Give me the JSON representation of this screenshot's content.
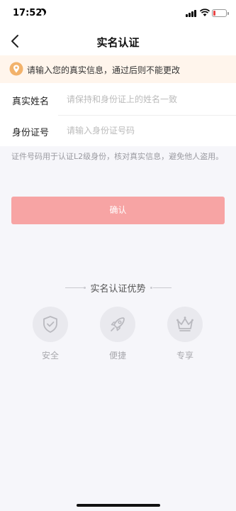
{
  "status_bar": {
    "time": "17:52",
    "icons": [
      "moon-icon",
      "signal-icon",
      "wifi-icon",
      "battery-icon"
    ],
    "battery_level": 0.15
  },
  "nav": {
    "title": "实名认证",
    "back_icon": "chevron-left-icon"
  },
  "notice": {
    "icon": "location-pin-icon",
    "text": "请输入您的真实信息，通过后则不能更改"
  },
  "form": {
    "name": {
      "label": "真实姓名",
      "placeholder": "请保持和身份证上的姓名一致",
      "value": ""
    },
    "id_number": {
      "label": "身份证号",
      "placeholder": "请输入身份证号码",
      "value": ""
    }
  },
  "hint": "证件号码用于认证L2级身份，核对真实信息，避免他人盗用。",
  "confirm_label": "确认",
  "advantages": {
    "title": "实名认证优势",
    "items": [
      {
        "label": "安全",
        "icon": "shield-check-icon"
      },
      {
        "label": "便捷",
        "icon": "rocket-icon"
      },
      {
        "label": "专享",
        "icon": "crown-icon"
      }
    ]
  },
  "colors": {
    "accent": "#f7a4a4",
    "notice_bg": "#fff5ec",
    "notice_icon": "#f2b26b",
    "page_bg": "#f6f6fa"
  }
}
